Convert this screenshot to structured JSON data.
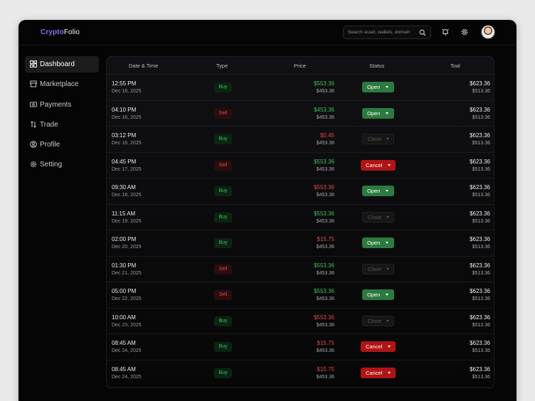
{
  "app": {
    "logo_part1": "Crypto",
    "logo_part2": "Folio"
  },
  "search": {
    "placeholder": "Search asset, wallets, domain"
  },
  "sidebar": {
    "items": [
      {
        "label": "Dashboard",
        "icon": "dashboard-icon",
        "active": true
      },
      {
        "label": "Marketplace",
        "icon": "store-icon",
        "active": false
      },
      {
        "label": "Payments",
        "icon": "payments-icon",
        "active": false
      },
      {
        "label": "Trade",
        "icon": "trade-icon",
        "active": false
      },
      {
        "label": "Profile",
        "icon": "profile-icon",
        "active": false
      },
      {
        "label": "Setting",
        "icon": "gear-icon",
        "active": false
      }
    ]
  },
  "table": {
    "columns": [
      "Date & Time",
      "Type",
      "Price",
      "Status",
      "Toal"
    ],
    "rows": [
      {
        "time": "12:55 PM",
        "date": "Dec 16, 2025",
        "type": "Buy",
        "price": "$553.36",
        "price_color": "green",
        "price_sub": "$453.36",
        "status": "Open",
        "total": "$623.36",
        "total_sub": "$513.36"
      },
      {
        "time": "04:10 PM",
        "date": "Dec 16, 2025",
        "type": "Sell",
        "price": "$453.36",
        "price_color": "green",
        "price_sub": "$453.36",
        "status": "Open",
        "total": "$623.36",
        "total_sub": "$513.36"
      },
      {
        "time": "03:12 PM",
        "date": "Dec 16, 2025",
        "type": "Buy",
        "price": "$0.45",
        "price_color": "red",
        "price_sub": "$453.36",
        "status": "Close",
        "total": "$623.36",
        "total_sub": "$513.36"
      },
      {
        "time": "04:45 PM",
        "date": "Dec 17, 2025",
        "type": "Sell",
        "price": "$553.36",
        "price_color": "green",
        "price_sub": "$453.36",
        "status": "Cancel",
        "total": "$623.36",
        "total_sub": "$513.36"
      },
      {
        "time": "09:30 AM",
        "date": "Dec 18, 2025",
        "type": "Buy",
        "price": "$553.36",
        "price_color": "red",
        "price_sub": "$453.36",
        "status": "Open",
        "total": "$623.36",
        "total_sub": "$513.36"
      },
      {
        "time": "11:15 AM",
        "date": "Dec 19, 2025",
        "type": "Buy",
        "price": "$553.36",
        "price_color": "green",
        "price_sub": "$453.36",
        "status": "Close",
        "total": "$623.36",
        "total_sub": "$513.36"
      },
      {
        "time": "02:00 PM",
        "date": "Dec 20, 2025",
        "type": "Buy",
        "price": "$15.75",
        "price_color": "red",
        "price_sub": "$453.36",
        "status": "Open",
        "total": "$623.36",
        "total_sub": "$513.36"
      },
      {
        "time": "01:30 PM",
        "date": "Dec 21, 2025",
        "type": "Sell",
        "price": "$553.36",
        "price_color": "green",
        "price_sub": "$453.36",
        "status": "Close",
        "total": "$623.36",
        "total_sub": "$513.36"
      },
      {
        "time": "05:00 PM",
        "date": "Dec 22, 2025",
        "type": "Sell",
        "price": "$553.36",
        "price_color": "green",
        "price_sub": "$453.36",
        "status": "Open",
        "total": "$623.36",
        "total_sub": "$513.36"
      },
      {
        "time": "10:00 AM",
        "date": "Dec 23, 2025",
        "type": "Buy",
        "price": "$553.36",
        "price_color": "red",
        "price_sub": "$453.36",
        "status": "Close",
        "total": "$623.36",
        "total_sub": "$513.36"
      },
      {
        "time": "08:45 AM",
        "date": "Dec 24, 2025",
        "type": "Buy",
        "price": "$15.75",
        "price_color": "red",
        "price_sub": "$453.36",
        "status": "Cancel",
        "total": "$623.36",
        "total_sub": "$513.36"
      },
      {
        "time": "08:45 AM",
        "date": "Dec 24, 2025",
        "type": "Buy",
        "price": "$15.75",
        "price_color": "red",
        "price_sub": "$453.36",
        "status": "Cancel",
        "total": "$623.36",
        "total_sub": "$513.36"
      }
    ]
  },
  "colors": {
    "accent": "#8b6cf5",
    "buy": "#3fbf5c",
    "sell": "#e04848",
    "open": "#2c7a3f",
    "cancel": "#b01414"
  }
}
